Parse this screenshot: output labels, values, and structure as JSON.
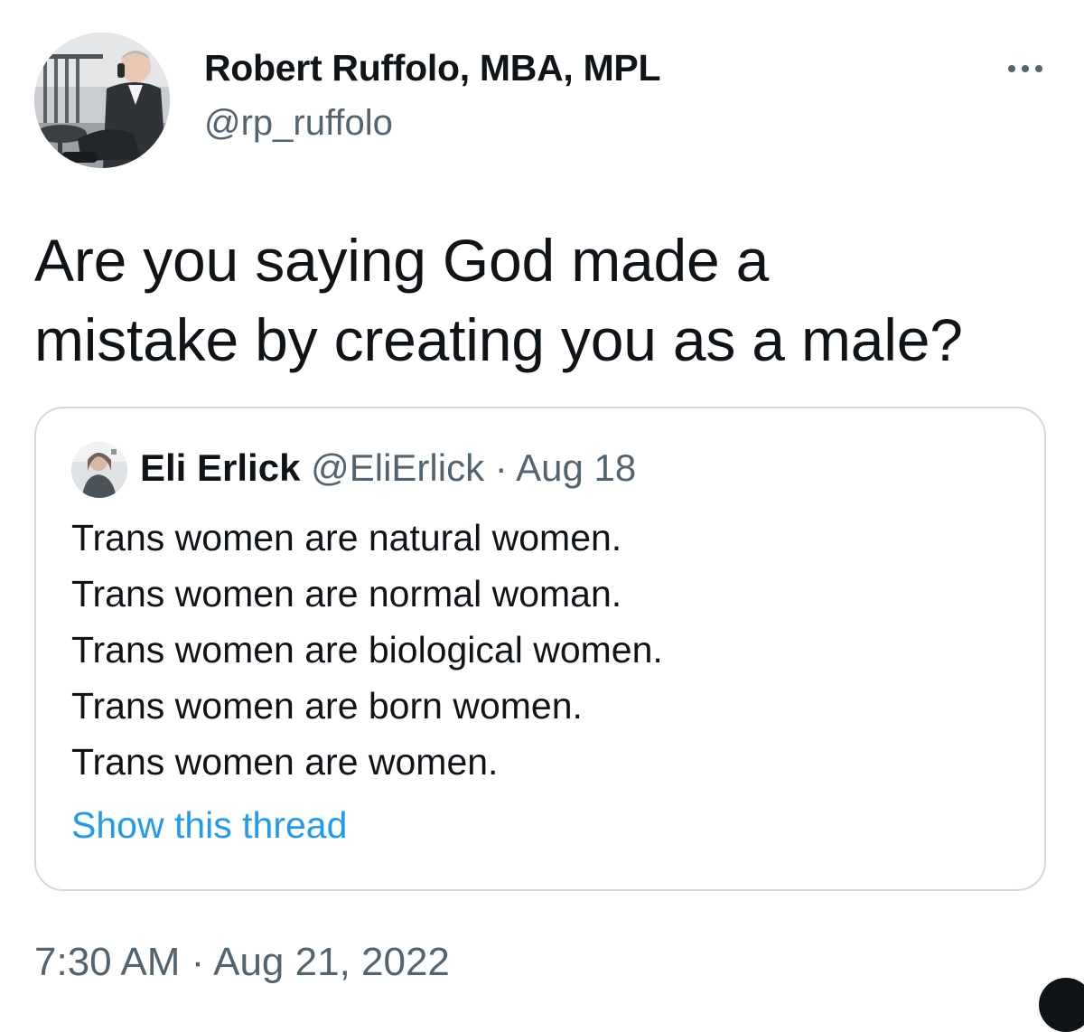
{
  "tweet": {
    "author": {
      "name": "Robert Ruffolo, MBA, MPL",
      "handle": "@rp_ruffolo",
      "avatar_icon": "profile-photo"
    },
    "more_icon": "ellipsis-icon",
    "text": "Are you saying God made a\nmistake by creating you as a male?",
    "timestamp": "7:30 AM · Aug 21, 2022"
  },
  "quote": {
    "name": "Eli Erlick",
    "handle": "@EliErlick",
    "separator": "·",
    "date": "Aug 18",
    "avatar_icon": "profile-photo",
    "lines": [
      "Trans women are natural women.",
      "Trans women are normal woman.",
      "Trans women are biological women.",
      "Trans women are born women.",
      "Trans women are women."
    ],
    "show_thread": "Show this thread"
  },
  "colors": {
    "text_primary": "#0f1419",
    "text_secondary": "#536471",
    "link": "#1d9bf0",
    "border": "#cfd9de"
  }
}
